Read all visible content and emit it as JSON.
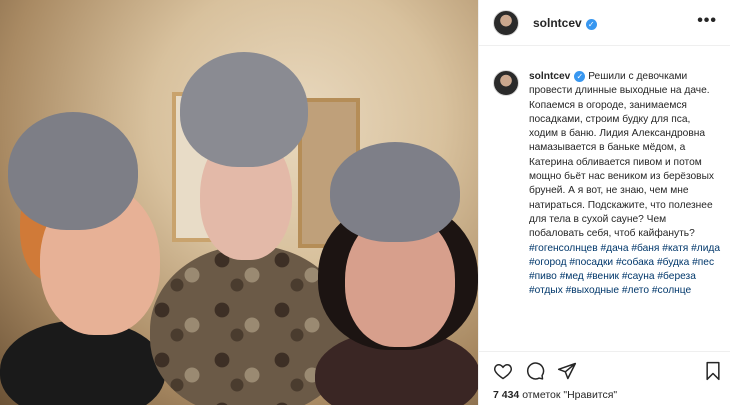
{
  "header": {
    "username": "solntcev",
    "verified_mark": "✓",
    "more_label": "•••"
  },
  "caption": {
    "username": "solntcev",
    "verified_mark": "✓",
    "text": "Решили с девочками провести длинные выходные на даче. Копаемся в огороде, занимаемся посадками, строим будку для пса, ходим в баню. Лидия Александровна намазывается в баньке мёдом, а Катерина обливается пивом и потом мощно бьёт нас веником из берёзовых бруней. А я вот, не знаю, чем мне натираться. Подскажите, что полезнее для тела в сухой сауне? Чем побаловать себя, чтоб кайфануть?",
    "hashtags": [
      "#гогенсолнцев",
      "#дача",
      "#баня",
      "#катя",
      "#лида",
      "#огород",
      "#посадки",
      "#собака",
      "#будка",
      "#пес",
      "#пиво",
      "#мед",
      "#веник",
      "#сауна",
      "#береза",
      "#отдых",
      "#выходные",
      "#лето",
      "#солнце"
    ]
  },
  "actions": {
    "icons": [
      "heart-icon",
      "comment-icon",
      "share-icon",
      "bookmark-icon"
    ],
    "likes_count": "7 434",
    "likes_label": "отметок \"Нравится\""
  },
  "colors": {
    "verified": "#3897f0",
    "hashtag": "#00376b",
    "text": "#262626",
    "border": "#efefef"
  }
}
